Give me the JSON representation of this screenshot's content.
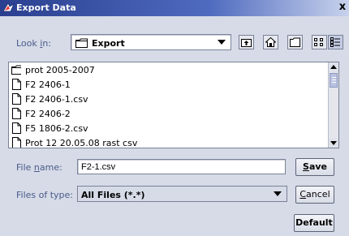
{
  "window": {
    "title": "Export Data",
    "close_glyph": "x"
  },
  "look_in": {
    "label_pre": "Look ",
    "label_mnemonic": "i",
    "label_post": "n:",
    "value": "Export"
  },
  "toolbar": [
    "up-one-level-icon",
    "home-icon",
    "new-folder-icon",
    "list-view-icon",
    "details-view-icon"
  ],
  "files": [
    {
      "name": "prot 2005-2007",
      "type": "folder"
    },
    {
      "name": "F2 2406-1",
      "type": "file"
    },
    {
      "name": "F2 2406-1.csv",
      "type": "file"
    },
    {
      "name": "F2 2406-2",
      "type": "file"
    },
    {
      "name": "F5 1806-2.csv",
      "type": "file"
    },
    {
      "name": "Prot 12     20.05.08  rast csv",
      "type": "file"
    }
  ],
  "file_name": {
    "label_pre": "File ",
    "label_mnemonic": "n",
    "label_post": "ame:",
    "value": "F2-1.csv"
  },
  "files_of_type": {
    "label": "Files of type:",
    "value": "All Files (*.*)"
  },
  "buttons": {
    "save_mnemonic": "S",
    "save_rest": "ave",
    "cancel_mnemonic": "C",
    "cancel_rest": "ancel",
    "default": "Default"
  }
}
